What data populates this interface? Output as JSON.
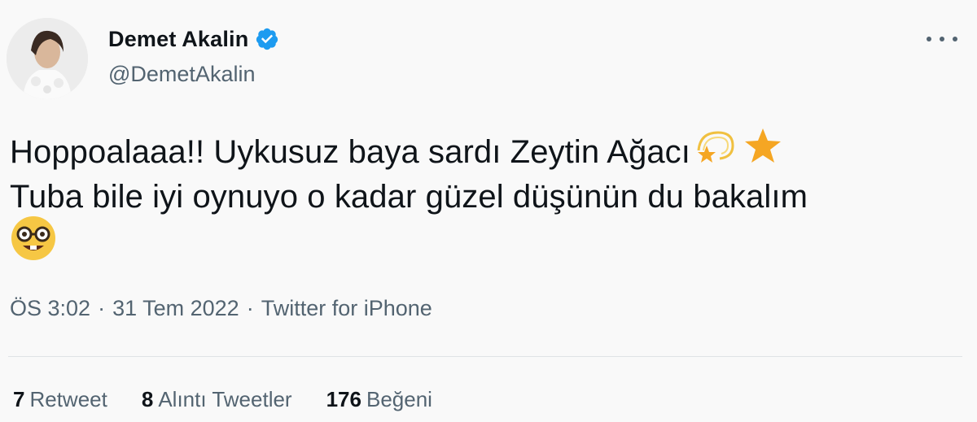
{
  "author": {
    "display_name": "Demet Akalin",
    "handle": "@DemetAkalin",
    "verified": true
  },
  "tweet": {
    "line1": "Hoppoalaaa!! Uykusuz baya sardı Zeytin Ağacı",
    "line2": "Tuba bile iyi oynuyo o kadar güzel düşünün du bakalım",
    "emojis": [
      "dizzy-emoji",
      "star-emoji",
      "nerd-face-emoji"
    ]
  },
  "meta": {
    "time": "ÖS 3:02",
    "date": "31 Tem 2022",
    "source": "Twitter for iPhone",
    "separator": "·"
  },
  "stats": {
    "retweets_count": "7",
    "retweets_label": "Retweet",
    "quotes_count": "8",
    "quotes_label": "Alıntı Tweetler",
    "likes_count": "176",
    "likes_label": "Beğeni"
  },
  "colors": {
    "verified_blue": "#1d9bf0",
    "secondary_text": "#536471",
    "primary_text": "#0f1419",
    "star_gold": "#f5a623"
  }
}
